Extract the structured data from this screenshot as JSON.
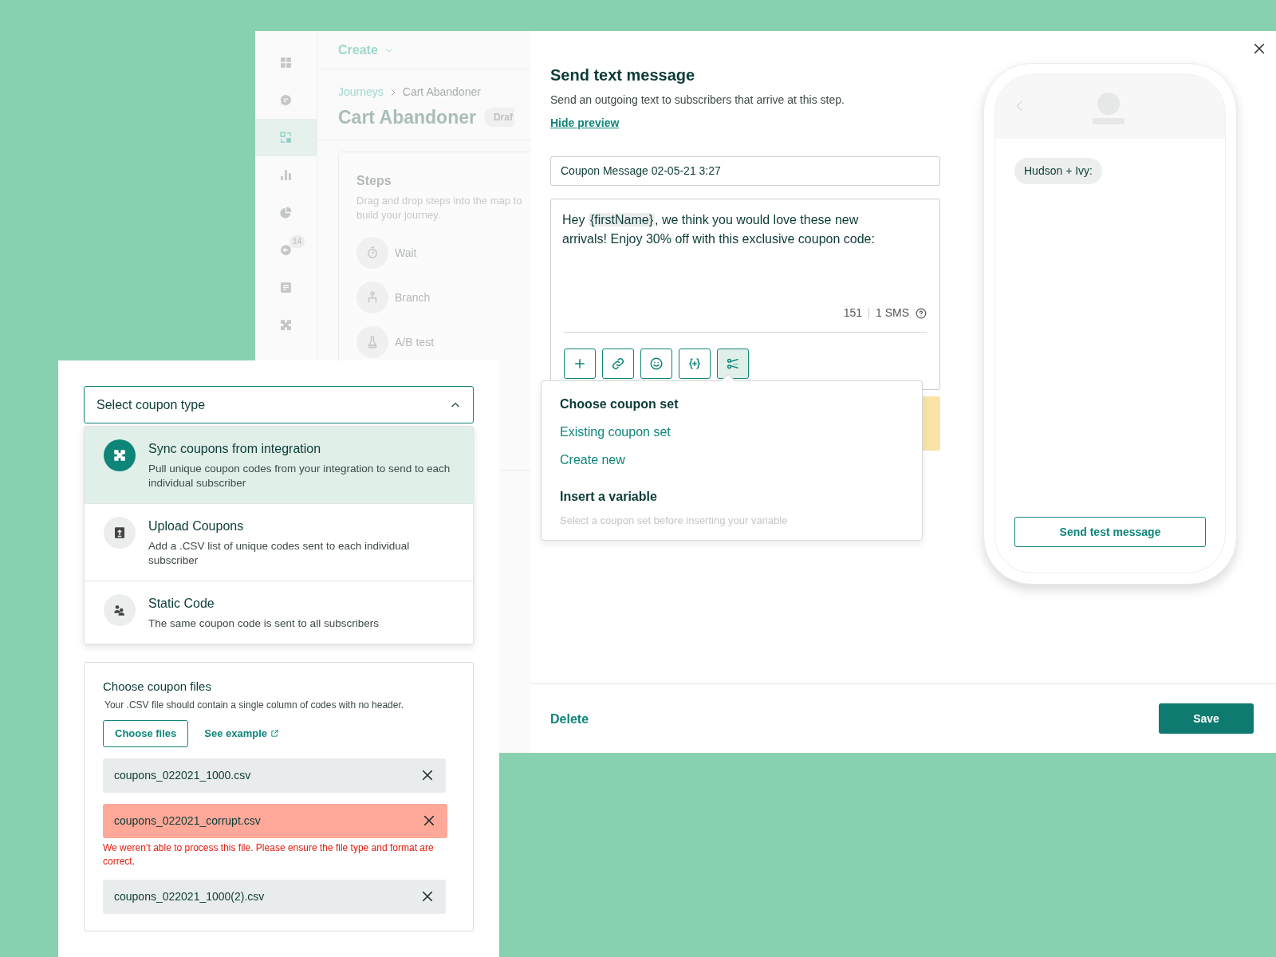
{
  "background_app": {
    "sidebar": {
      "items": [
        {
          "selected": false
        },
        {
          "selected": false
        },
        {
          "selected": true
        },
        {
          "selected": false
        },
        {
          "selected": false
        },
        {
          "selected": false,
          "badge": "14"
        },
        {
          "selected": false
        },
        {
          "selected": false
        }
      ]
    },
    "create_menu": "Create",
    "breadcrumb": [
      "Journeys",
      "Cart Abandoner"
    ],
    "title": "Cart Abandoner",
    "status": "Draf",
    "steps_panel": {
      "title": "Steps",
      "description": "Drag and drop steps into the map to build your journey.",
      "steps": [
        {
          "label": "Wait"
        },
        {
          "label": "Branch"
        },
        {
          "label": "A/B test"
        }
      ]
    }
  },
  "modal": {
    "title": "Send text message",
    "description": "Send an outgoing text to subscribers that arrive at this step.",
    "preview_link": "Hide preview",
    "name_field": "Coupon Message 02-05-21 3:27",
    "message": [
      {
        "kind": "text",
        "text": "Hey "
      },
      {
        "kind": "variable",
        "text": "{firstName}"
      },
      {
        "kind": "text",
        "text": ", we think you would love these new arrivals! Enjoy 30% off with this exclusive coupon code:"
      }
    ],
    "char_count": "151",
    "sms_count": "1 SMS",
    "toolbar": [
      {
        "selected": false
      },
      {
        "selected": false
      },
      {
        "selected": false
      },
      {
        "selected": false
      },
      {
        "selected": true
      }
    ],
    "popover": {
      "sections": [
        {
          "heading": "Choose coupon set",
          "options": [
            "Existing coupon set",
            "Create new"
          ]
        },
        {
          "heading": "Insert a variable",
          "hint": "Select a coupon set before inserting your variable"
        }
      ]
    },
    "delete": "Delete",
    "save": "Save"
  },
  "phone": {
    "sender": "Hudson + Ivy:",
    "button": "Send test message"
  },
  "coupon_type_select": {
    "value": "Select coupon type",
    "expanded": true,
    "options": [
      {
        "title": "Sync coupons from integration",
        "description": "Pull unique coupon codes from your integration to send to each individual subscriber",
        "selected": true
      },
      {
        "title": "Upload Coupons",
        "description": "Add a .CSV list of unique codes sent to each individual subscriber",
        "selected": false
      },
      {
        "title": "Static Code",
        "description": "The same coupon code is sent to all subscribers",
        "selected": false
      }
    ]
  },
  "coupon_files": {
    "title": "Choose coupon files",
    "description": "Your .CSV file should contain a single column of codes with no header.",
    "choose_button": "Choose files",
    "example_link": "See example",
    "files": [
      {
        "name": "coupons_022021_1000.csv",
        "failed": false
      },
      {
        "name": "coupons_022021_corrupt.csv",
        "failed": true,
        "error": "We weren’t able to process this file. Please ensure the file type and format are correct."
      },
      {
        "name": "coupons_022021_1000(2).csv",
        "failed": false
      }
    ]
  }
}
